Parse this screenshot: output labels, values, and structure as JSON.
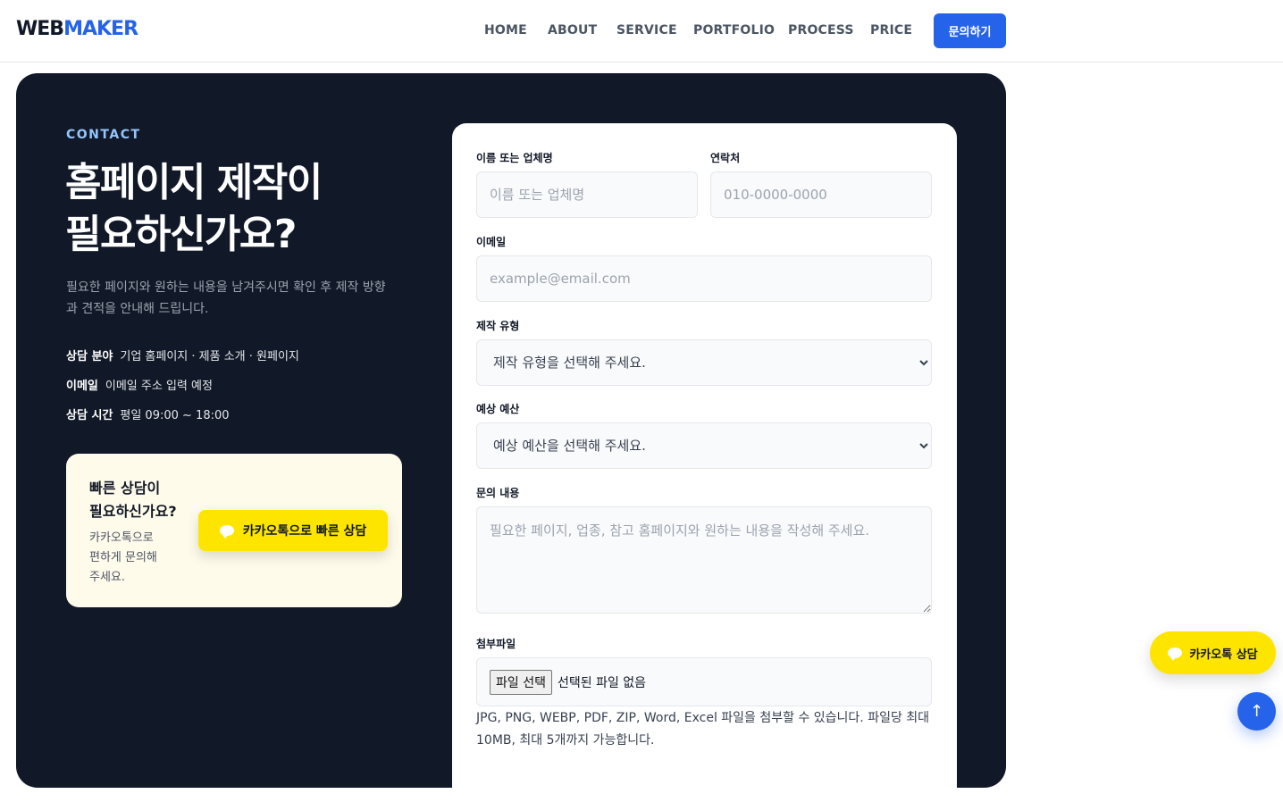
{
  "header": {
    "logo_a": "WEB",
    "logo_b": "MAKER",
    "nav": [
      "HOME",
      "ABOUT",
      "SERVICE",
      "PORTFOLIO",
      "PROCESS",
      "PRICE"
    ],
    "cta": "문의하기"
  },
  "contact": {
    "eyebrow": "CONTACT",
    "title": "홈페이지 제작이\n필요하신가요?",
    "description": "필요한 페이지와 원하는 내용을 남겨주시면 확인 후 제작 방향과 견적을 안내해 드립니다.",
    "info": [
      {
        "key": "상담 분야",
        "value": "기업 홈페이지 · 제품 소개 · 원페이지"
      },
      {
        "key": "이메일",
        "value": "이메일 주소 입력 예정"
      },
      {
        "key": "상담 시간",
        "value": "평일 09:00 ~ 18:00"
      }
    ],
    "kakao_box": {
      "title": "빠른 상담이\n필요하신가요?",
      "desc": "카카오톡으로\n편하게 문의해\n주세요.",
      "button": "카카오톡으로 빠른 상담"
    }
  },
  "form": {
    "name_label": "이름 또는 업체명",
    "name_placeholder": "이름 또는 업체명",
    "phone_label": "연락처",
    "phone_placeholder": "010-0000-0000",
    "email_label": "이메일",
    "email_placeholder": "example@email.com",
    "type_label": "제작 유형",
    "type_selected": "제작 유형을 선택해 주세요.",
    "budget_label": "예상 예산",
    "budget_selected": "예상 예산을 선택해 주세요.",
    "message_label": "문의 내용",
    "message_placeholder": "필요한 페이지, 업종, 참고 홈페이지와 원하는 내용을 작성해 주세요.",
    "file_label": "첨부파일",
    "file_button": "파일 선택",
    "file_status": "선택된 파일 없음",
    "file_help": "JPG, PNG, WEBP, PDF, ZIP, Word, Excel 파일을 첨부할 수 있습니다. 파일당 최대 10MB, 최대 5개까지 가능합니다."
  },
  "floating": {
    "kakao": "카카오톡 상담",
    "top_icon": "↑"
  },
  "colors": {
    "accent": "#2563eb",
    "panel": "#111827",
    "kakao": "#fee500"
  }
}
